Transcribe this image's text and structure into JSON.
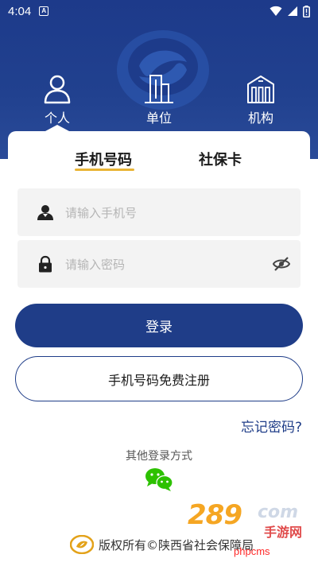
{
  "status_bar": {
    "time": "4:04",
    "notification_badge": "A",
    "icons": [
      "wifi-icon",
      "signal-icon",
      "battery-icon"
    ]
  },
  "user_tabs": [
    {
      "label": "个人",
      "icon": "person-icon",
      "selected": true
    },
    {
      "label": "单位",
      "icon": "building-icon",
      "selected": false
    },
    {
      "label": "机构",
      "icon": "institution-icon",
      "selected": false
    }
  ],
  "login_tabs": {
    "phone": "手机号码",
    "social_card": "社保卡",
    "active": "phone"
  },
  "form": {
    "phone_placeholder": "请输入手机号",
    "password_placeholder": "请输入密码"
  },
  "buttons": {
    "login": "登录",
    "register": "手机号码免费注册"
  },
  "links": {
    "forgot_password": "忘记密码?"
  },
  "other_login": {
    "label": "其他登录方式",
    "methods": [
      "wechat-icon"
    ]
  },
  "footer": {
    "copyright": "版权所有©陕西省社会保障局"
  },
  "watermark": {
    "brand": "289",
    "domain": "com",
    "subtitle": "手游网",
    "site": "phpcms"
  },
  "colors": {
    "primary": "#1f3d88",
    "header": "#21418f",
    "accent_underline": "#e9b436",
    "field_bg": "#f3f3f3",
    "wechat": "#2dc100"
  }
}
